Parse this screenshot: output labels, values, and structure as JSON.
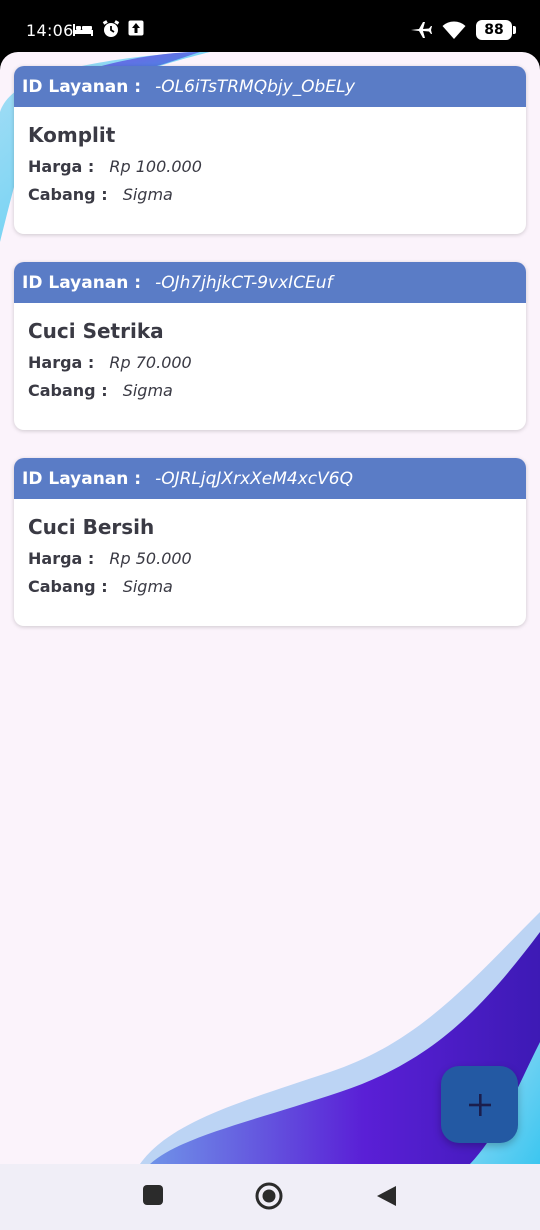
{
  "status_bar": {
    "time": "14:06",
    "battery_level": "88",
    "icons_left": [
      "bed-icon",
      "alarm-icon",
      "upload-icon"
    ],
    "icons_right": [
      "airplane-icon",
      "wifi-icon",
      "battery-icon"
    ]
  },
  "services": [
    {
      "id_label": "ID Layanan :",
      "id_value": "-OL6iTsTRMQbjy_ObELy",
      "name": "Komplit",
      "price_label": "Harga :",
      "price_value": "Rp 100.000",
      "branch_label": "Cabang :",
      "branch_value": "Sigma"
    },
    {
      "id_label": "ID Layanan :",
      "id_value": "-OJh7jhjkCT-9vxICEuf",
      "name": "Cuci Setrika",
      "price_label": "Harga :",
      "price_value": "Rp 70.000",
      "branch_label": "Cabang :",
      "branch_value": "Sigma"
    },
    {
      "id_label": "ID Layanan :",
      "id_value": "-OJRLjqJXrxXeM4xcV6Q",
      "name": "Cuci Bersih",
      "price_label": "Harga :",
      "price_value": "Rp 50.000",
      "branch_label": "Cabang :",
      "branch_value": "Sigma"
    }
  ],
  "fab": {
    "icon": "plus-icon",
    "label": "+"
  },
  "nav_bar": {
    "buttons": [
      "recents-square-icon",
      "home-circle-icon",
      "back-triangle-icon"
    ]
  },
  "colors": {
    "card_header": "#5a7cc6",
    "page_bg": "#fbf3fb",
    "fab_bg": "#2359a3",
    "text_dark": "#3a3a44",
    "wave_purple": "#5a1fd6",
    "wave_blue": "#3cc6f0"
  }
}
